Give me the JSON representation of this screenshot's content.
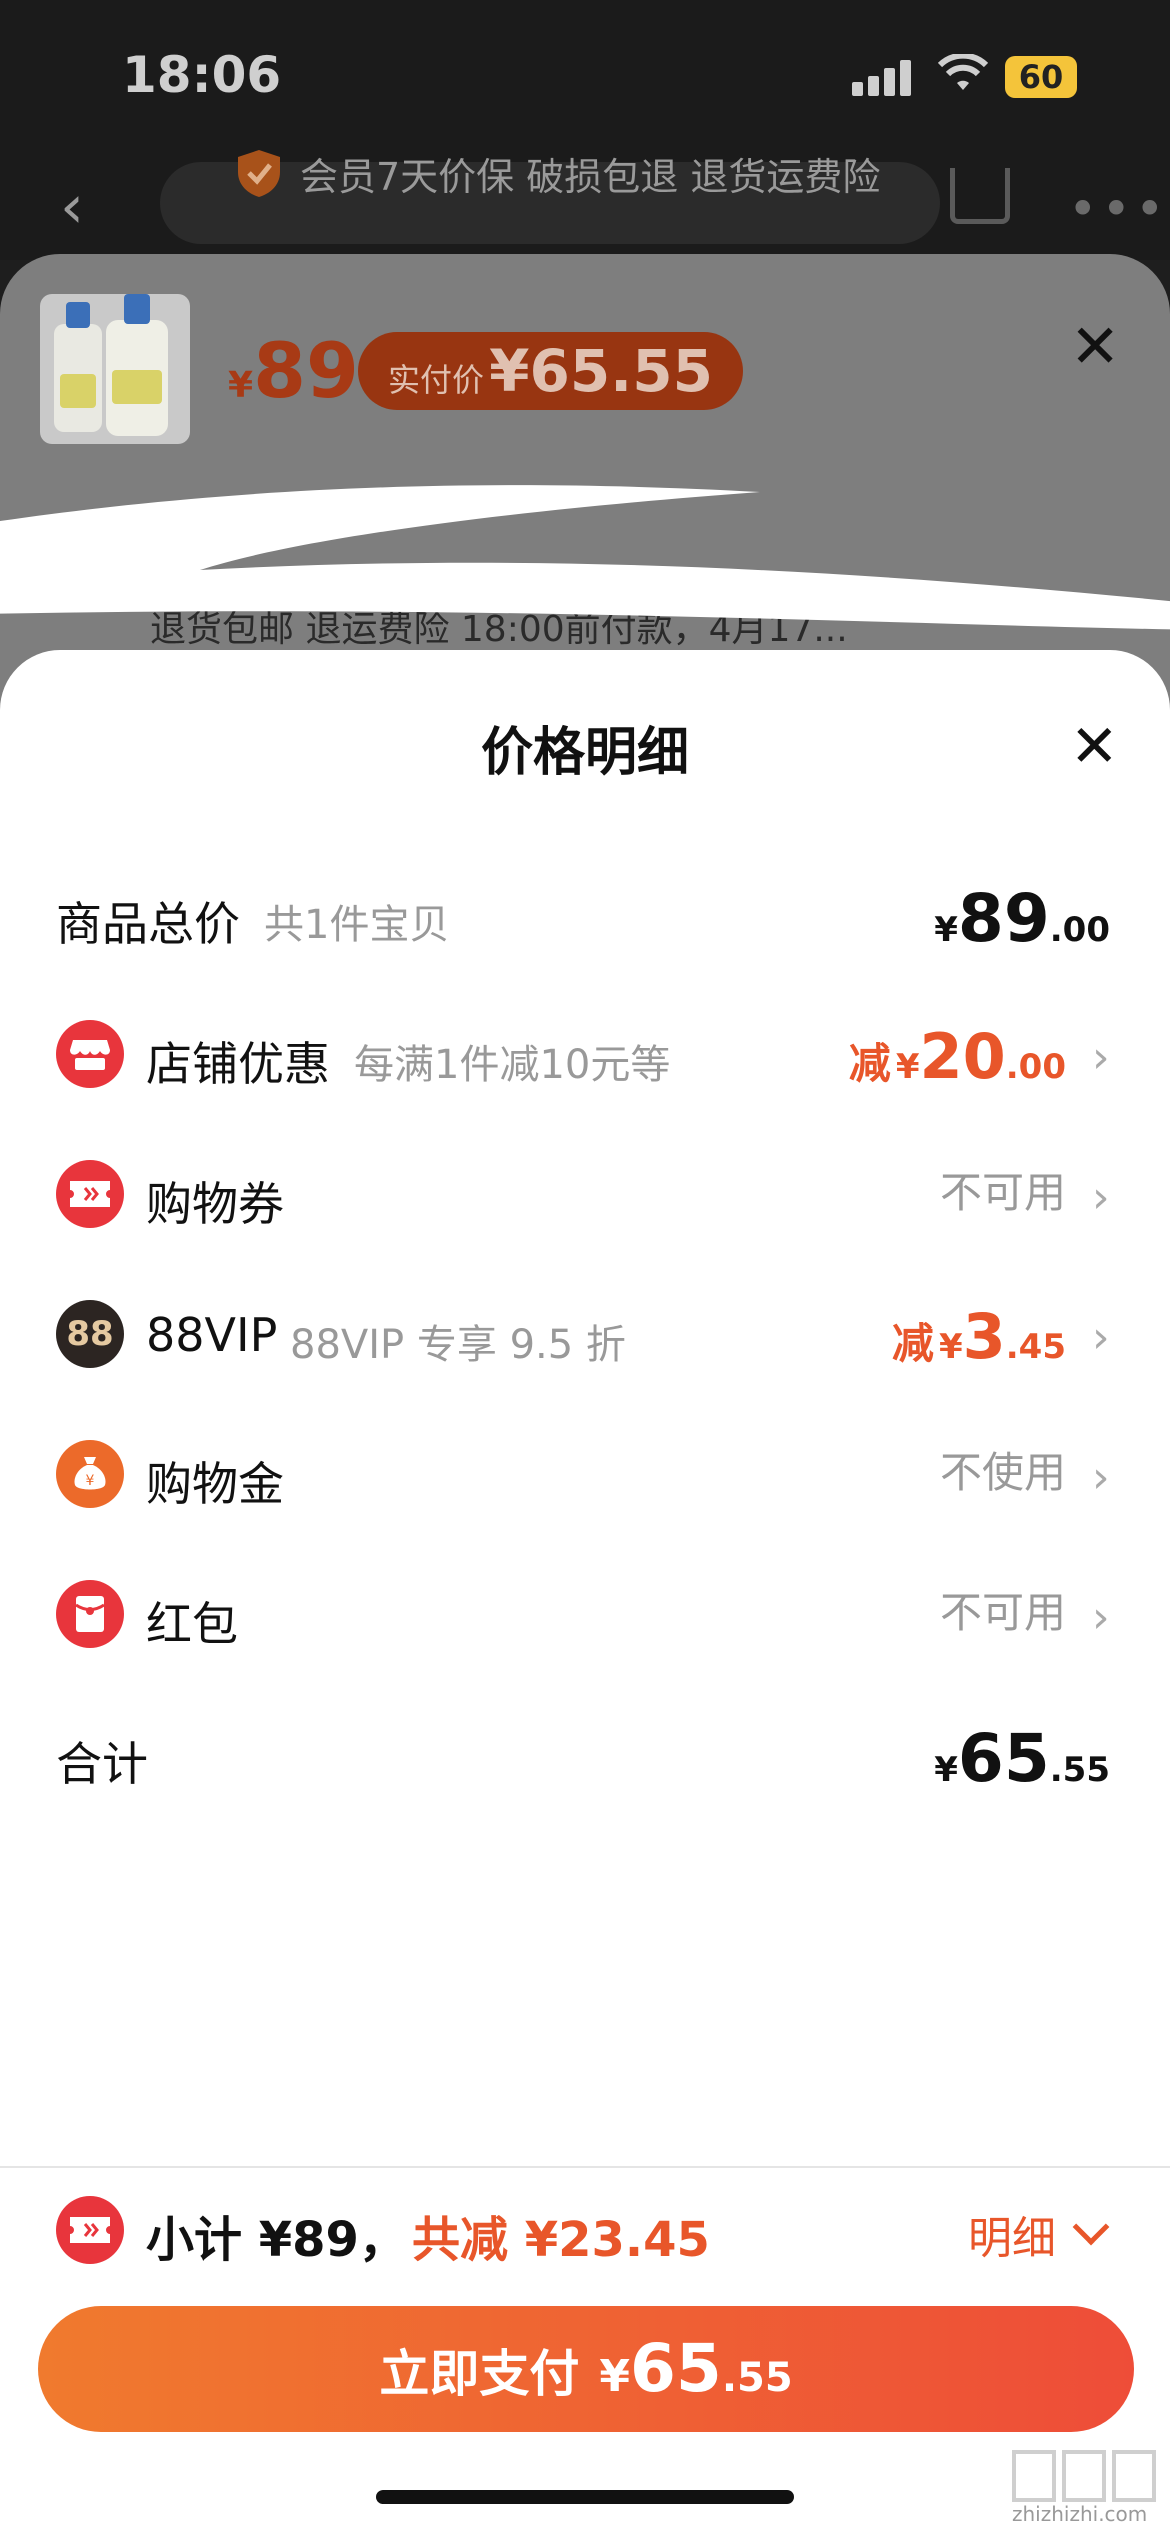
{
  "status_bar": {
    "time": "18:06",
    "battery": "60"
  },
  "top": {
    "guarantee_text": "会员7天价保 破损包退 退货运费险"
  },
  "product_sheet": {
    "currency": "¥",
    "price": "89",
    "real_price_label": "实付价",
    "real_price": "¥65.55",
    "partial_text": "退货包邮 退运费险 18:00前付款，4月17..."
  },
  "price_detail": {
    "title": "价格明细",
    "rows": {
      "total": {
        "label": "商品总价",
        "sub": "共1件宝贝",
        "yen": "¥",
        "int": "89",
        "dec": ".00"
      },
      "store": {
        "label": "店铺优惠",
        "sub": "每满1件减10元等",
        "prefix": "减",
        "yen": "¥",
        "int": "20",
        "dec": ".00",
        "icon": "store-icon"
      },
      "coupon": {
        "label": "购物券",
        "status": "不可用",
        "icon": "ticket-icon"
      },
      "vip": {
        "label": "88VIP",
        "sub": "88VIP 专享 9.5 折",
        "prefix": "减",
        "yen": "¥",
        "int": "3",
        "dec": ".45",
        "icon_text": "88"
      },
      "gold": {
        "label": "购物金",
        "status": "不使用",
        "icon": "money-bag-icon"
      },
      "redpacket": {
        "label": "红包",
        "status": "不可用",
        "icon": "red-packet-icon"
      },
      "sum": {
        "label": "合计",
        "yen": "¥",
        "int": "65",
        "dec": ".55"
      }
    }
  },
  "bottom_bar": {
    "subtotal": "小计 ¥89，",
    "saving": "共减 ¥23.45",
    "detail": "明细",
    "pay_label": "立即支付",
    "pay_yen": "¥",
    "pay_int": "65",
    "pay_dec": ".55"
  },
  "watermark": {
    "text": "zhizhizhi.com"
  },
  "colors": {
    "accent": "#e8562a",
    "icon_red": "#e8353c",
    "button_start": "#f07a2e",
    "button_end": "#ee4d38"
  }
}
